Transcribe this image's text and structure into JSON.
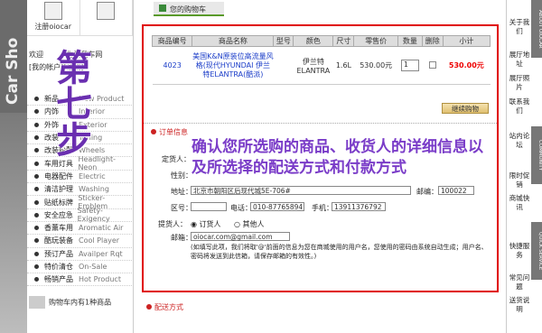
{
  "left_brand": {
    "vertical_text": "Car Sho"
  },
  "sidebar": {
    "register_label": "注册oiocar",
    "mycar_label": "我的购物车",
    "welcome_line1": "欢迎",
    "welcome_line1b": "为爱我车网",
    "welcome_line2": "[我的帐户][注销]",
    "categories": [
      {
        "cn": "新品",
        "en": "New Product"
      },
      {
        "cn": "内饰",
        "en": "Interior"
      },
      {
        "cn": "外饰",
        "en": "Exterior"
      },
      {
        "cn": "改装",
        "en": "Tuning"
      },
      {
        "cn": "改装轮毂",
        "en": "Wheels"
      },
      {
        "cn": "车用灯具",
        "en": "Headlight-Neon"
      },
      {
        "cn": "电器配件",
        "en": "Electric"
      },
      {
        "cn": "清洁护理",
        "en": "Washing"
      },
      {
        "cn": "贴纸标牌",
        "en": "Sticker-Emblem"
      },
      {
        "cn": "安全应急",
        "en": "Safety-Exigency"
      },
      {
        "cn": "香薰车用",
        "en": "Aromatic Air"
      },
      {
        "cn": "酷玩装备",
        "en": "Cool Player"
      },
      {
        "cn": "预订产品",
        "en": "Availper Rqt"
      },
      {
        "cn": "特价清仓",
        "en": "On-Sale"
      },
      {
        "cn": "畅销产品",
        "en": "Hot Product"
      }
    ],
    "cart_info": "购物车内有1种商品"
  },
  "step_label": "第七步",
  "main": {
    "title": "您的购物车",
    "table_headers": [
      "商品编号",
      "商品名称",
      "型号",
      "颜色",
      "尺寸",
      "零售价",
      "数量",
      "删除",
      "小计"
    ],
    "row": {
      "code": "4023",
      "name": "美国K&N原装位高流量风格(现代HYUNDAI 伊兰特ELANTRA(酷派)",
      "model": "伊兰特ELANTRA",
      "size": "1.6L",
      "price": "530.00元",
      "qty": "1",
      "subtotal": "530.00元"
    },
    "continue_label": "继续购物",
    "order_title": "订单信息",
    "form": {
      "buyer_label": "定货人：",
      "gender_label": "性别：",
      "address_label": "地址：",
      "address_value": "北京市朝阳区后现代城5E-706#",
      "postcode_label": "邮编：",
      "postcode_value": "100022",
      "area_label": "区号：",
      "phone_label": "电话：",
      "phone_value": "010-87765894",
      "mobile_label": "手机：",
      "mobile_value": "13911376792",
      "receiver_label": "提货人：",
      "receiver_opt1": "订货人",
      "receiver_opt2": "其他人",
      "email_label": "邮箱：",
      "email_value": "oiocar.com@gmail.com",
      "note": "(如填写此项，我们将取'@'前面的信息为您在商城使用的用户名，您使用的密码由系统自动生成；用户名、密码将发送到此信箱，请保存邮箱的有效性。)"
    },
    "overlay_text": "确认您所选购的商品、收货人的详细信息以及所选择的配送方式和付款方式",
    "delivery_title": "配送方式"
  },
  "right_panel": {
    "tabs": [
      "ABOUT OIOCAR",
      "COMMUNITY",
      "QUICK SERVICE"
    ],
    "links": [
      "关于我们",
      "展厅地址",
      "展厅照片",
      "联系我们",
      "站内论坛",
      "限时促销",
      "商城快讯",
      "快捷服务",
      "常见问题",
      "送货说明"
    ]
  }
}
